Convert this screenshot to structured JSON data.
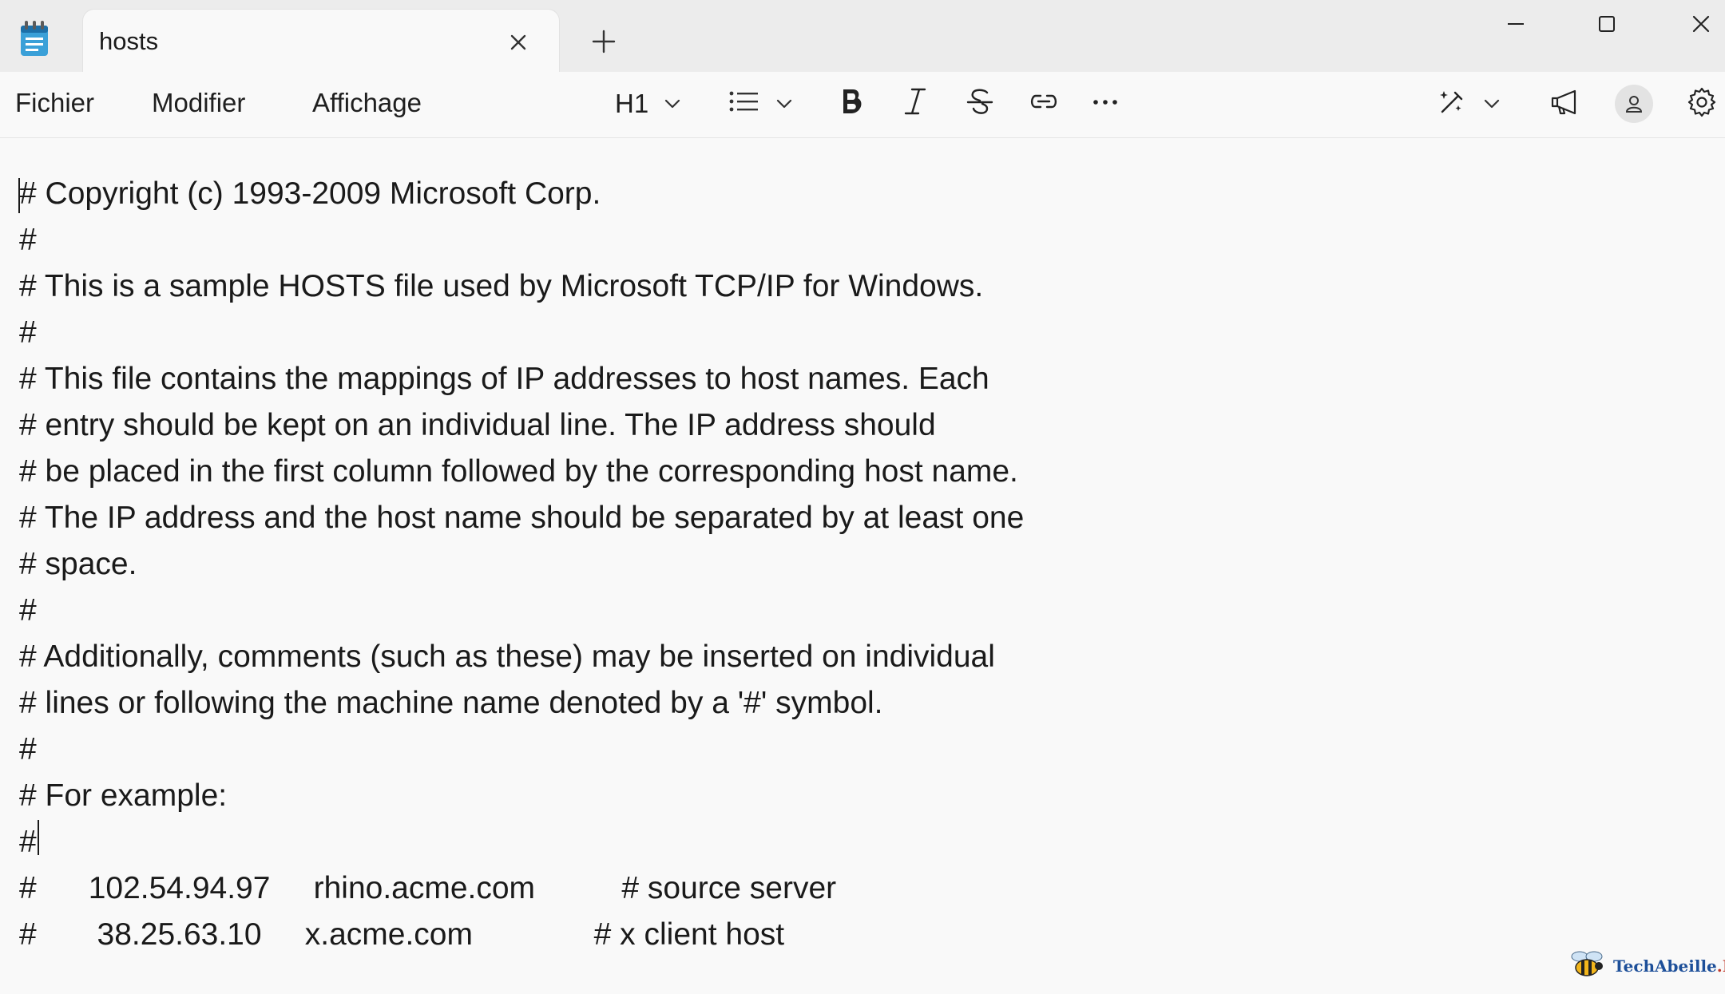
{
  "tab": {
    "title": "hosts"
  },
  "menu": {
    "file": "Fichier",
    "edit": "Modifier",
    "view": "Affichage"
  },
  "toolbar": {
    "heading": "H1",
    "tools": [
      "list-icon",
      "bold-icon",
      "italic-icon",
      "strikethrough-icon",
      "link-icon",
      "more-icon",
      "copilot-icon",
      "announcement-icon",
      "avatar-icon",
      "gear-icon"
    ]
  },
  "editor": {
    "lines": [
      "# Copyright (c) 1993-2009 Microsoft Corp.",
      "#",
      "# This is a sample HOSTS file used by Microsoft TCP/IP for Windows.",
      "#",
      "# This file contains the mappings of IP addresses to host names. Each",
      "# entry should be kept on an individual line. The IP address should",
      "# be placed in the first column followed by the corresponding host name.",
      "# The IP address and the host name should be separated by at least one",
      "# space.",
      "#",
      "# Additionally, comments (such as these) may be inserted on individual",
      "# lines or following the machine name denoted by a '#' symbol.",
      "#",
      "# For example:",
      "#",
      "#      102.54.94.97     rhino.acme.com          # source server",
      "#       38.25.63.10     x.acme.com              # x client host"
    ]
  },
  "watermark": {
    "name": "TechAbeille",
    "suffix": ".FR"
  },
  "colors": {
    "titlebar": "#ececec",
    "background": "#f9f9f9",
    "text": "#1a1a1a"
  }
}
